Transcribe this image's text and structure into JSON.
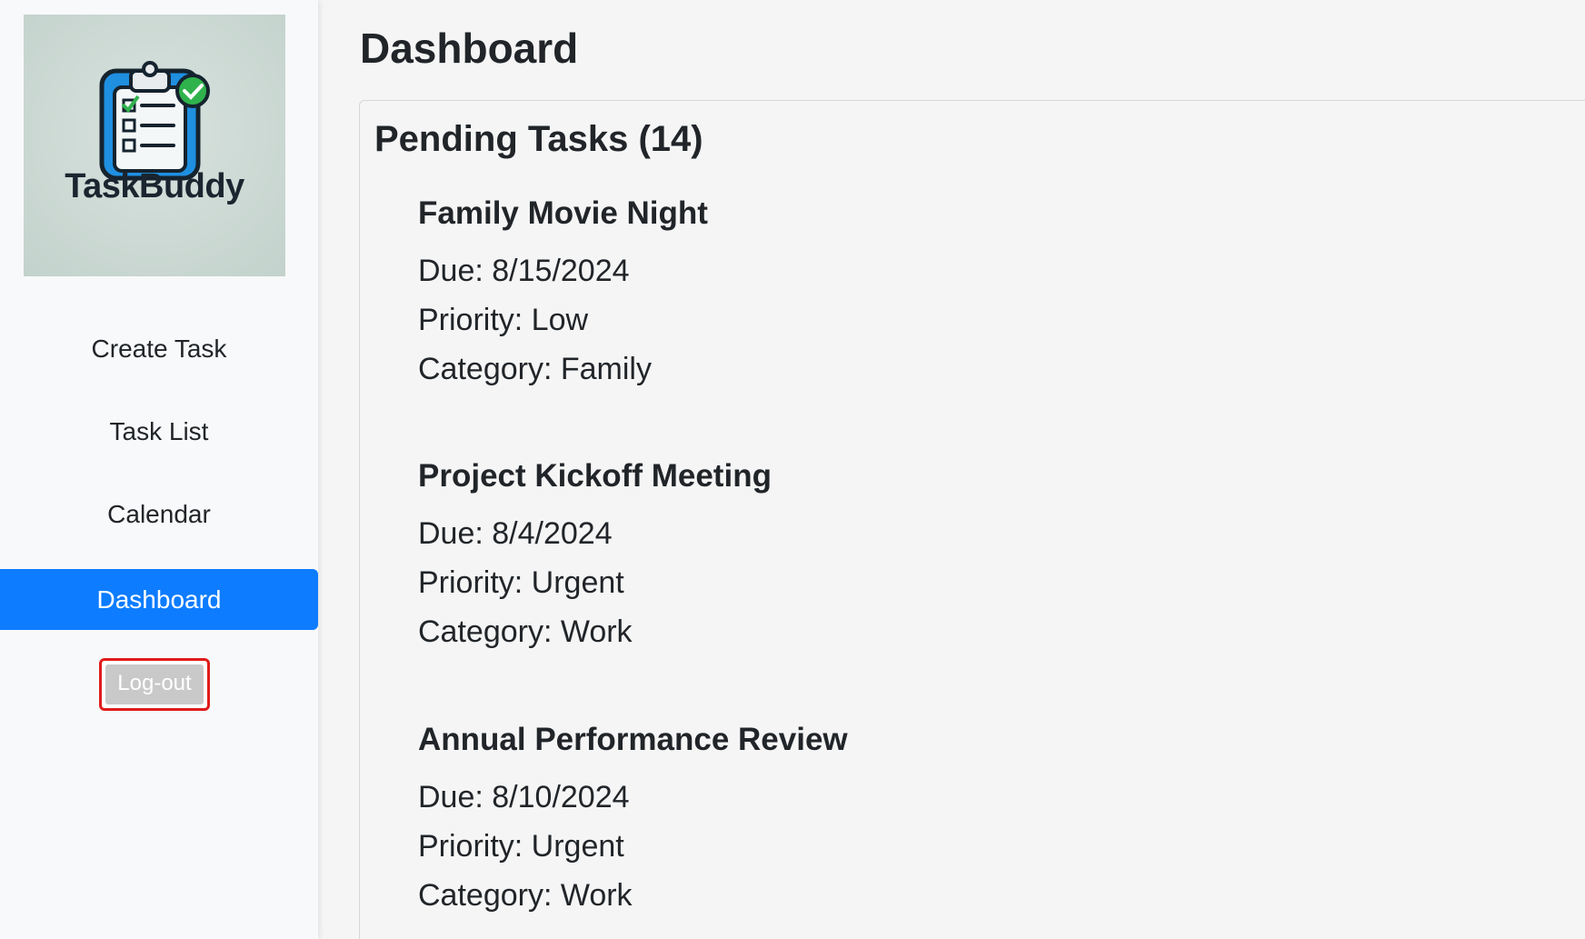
{
  "sidebar": {
    "logo_text": "TaskBuddy",
    "nav": [
      {
        "label": "Create Task"
      },
      {
        "label": "Task List"
      },
      {
        "label": "Calendar"
      },
      {
        "label": "Dashboard"
      }
    ],
    "logout_label": "Log-out"
  },
  "main": {
    "title": "Dashboard",
    "pending_title": "Pending Tasks (14)",
    "tasks": [
      {
        "name": "Family Movie Night",
        "due": "Due: 8/15/2024",
        "priority": "Priority: Low",
        "category": "Category: Family"
      },
      {
        "name": "Project Kickoff Meeting",
        "due": "Due: 8/4/2024",
        "priority": "Priority: Urgent",
        "category": "Category: Work"
      },
      {
        "name": "Annual Performance Review",
        "due": "Due: 8/10/2024",
        "priority": "Priority: Urgent",
        "category": "Category: Work"
      }
    ]
  },
  "colors": {
    "active_nav": "#0d7cff",
    "logout_border": "#e01b1b",
    "logo_blue": "#1f8fe0",
    "check_green": "#2fb24c"
  },
  "icons": {
    "logo": "clipboard-checklist-icon"
  }
}
